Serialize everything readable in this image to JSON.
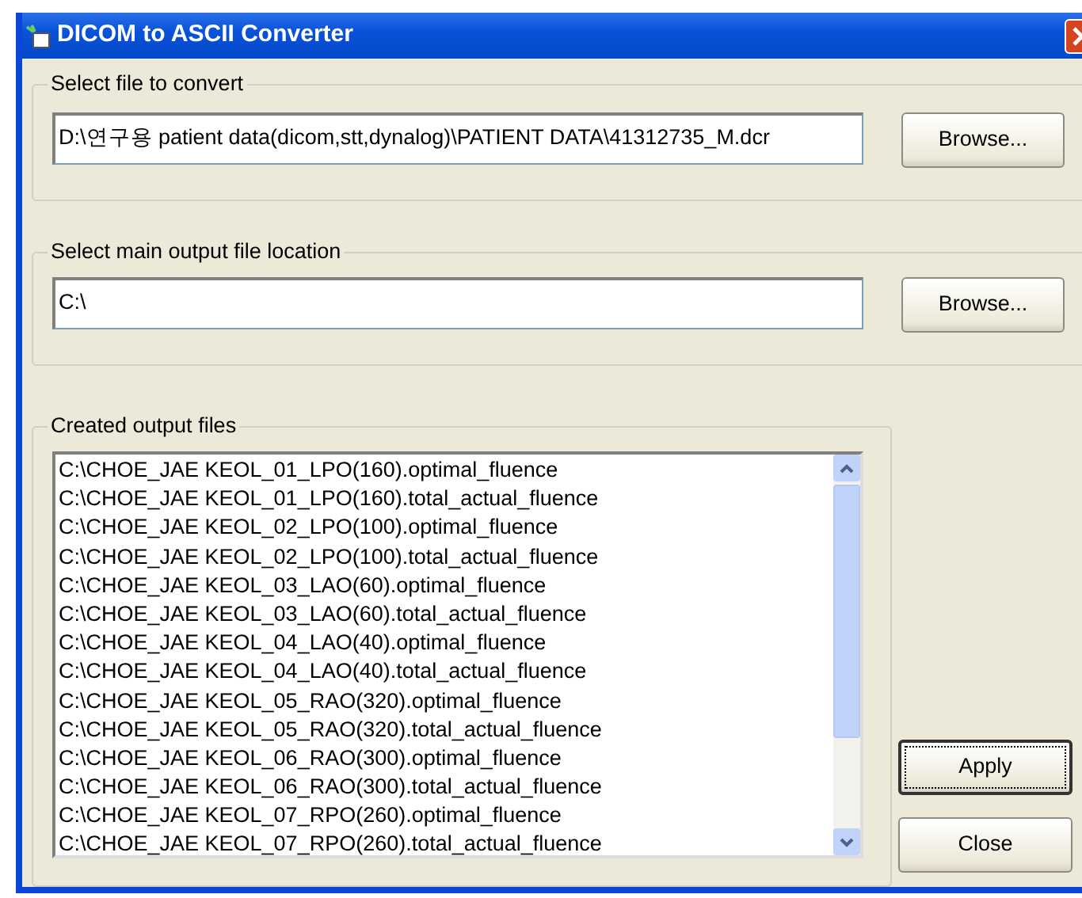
{
  "window": {
    "title": "DICOM to ASCII Converter"
  },
  "input_group": {
    "label": "Select file to convert",
    "value": "D:\\연구용 patient data(dicom,stt,dynalog)\\PATIENT DATA\\41312735_M.dcr",
    "button": {
      "label": "Browse...",
      "focused": false
    }
  },
  "output_group": {
    "label": "Select main output file location",
    "value": "C:\\",
    "button": {
      "label": "Browse...",
      "focused": false
    }
  },
  "files_group": {
    "label": "Created output files",
    "items": [
      "C:\\CHOE_JAE KEOL_01_LPO(160).optimal_fluence",
      "C:\\CHOE_JAE KEOL_01_LPO(160).total_actual_fluence",
      "C:\\CHOE_JAE KEOL_02_LPO(100).optimal_fluence",
      "C:\\CHOE_JAE KEOL_02_LPO(100).total_actual_fluence",
      "C:\\CHOE_JAE KEOL_03_LAO(60).optimal_fluence",
      "C:\\CHOE_JAE KEOL_03_LAO(60).total_actual_fluence",
      "C:\\CHOE_JAE KEOL_04_LAO(40).optimal_fluence",
      "C:\\CHOE_JAE KEOL_04_LAO(40).total_actual_fluence",
      "C:\\CHOE_JAE KEOL_05_RAO(320).optimal_fluence",
      "C:\\CHOE_JAE KEOL_05_RAO(320).total_actual_fluence",
      "C:\\CHOE_JAE KEOL_06_RAO(300).optimal_fluence",
      "C:\\CHOE_JAE KEOL_06_RAO(300).total_actual_fluence",
      "C:\\CHOE_JAE KEOL_07_RPO(260).optimal_fluence",
      "C:\\CHOE_JAE KEOL_07_RPO(260).total_actual_fluence"
    ]
  },
  "buttons": [
    {
      "label": "Apply",
      "focused": true
    },
    {
      "label": "Close",
      "focused": false
    }
  ]
}
